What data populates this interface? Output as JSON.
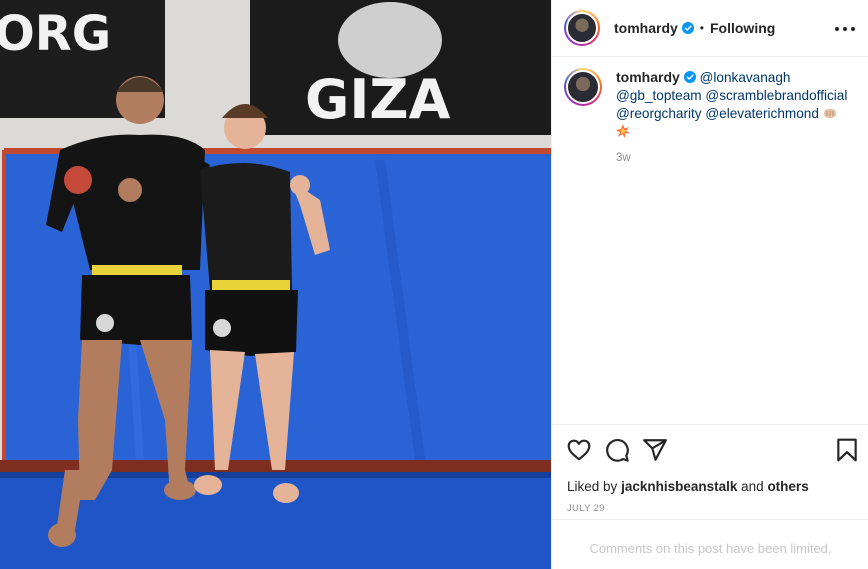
{
  "post": {
    "username": "tomhardy",
    "follow_state": "Following",
    "separator": "•",
    "image_alt": "Two athletes posing on a blue wrestling mat in front of GIZA and ORG banners",
    "banners": {
      "left": "ORG",
      "right": "GIZA"
    }
  },
  "caption": {
    "username": "tomhardy",
    "mentions": [
      "@lonkavanagh",
      "@gb_topteam",
      "@scramblebrandofficial",
      "@reorgcharity",
      "@elevaterichmond"
    ],
    "age": "3w"
  },
  "engagement": {
    "liked_prefix": "Liked by",
    "liked_user": "jacknhisbeanstalk",
    "liked_and": "and",
    "liked_others": "others",
    "date": "JULY 29"
  },
  "comments": {
    "limited_notice": "Comments on this post have been limited."
  },
  "icons": {
    "verified": "verified-badge-icon",
    "more": "more-options-icon",
    "like": "heart-icon",
    "comment": "comment-icon",
    "share": "share-icon",
    "save": "bookmark-icon"
  },
  "colors": {
    "verified": "#0095f6",
    "mention": "#00376b",
    "mat": "#1f55c7"
  }
}
